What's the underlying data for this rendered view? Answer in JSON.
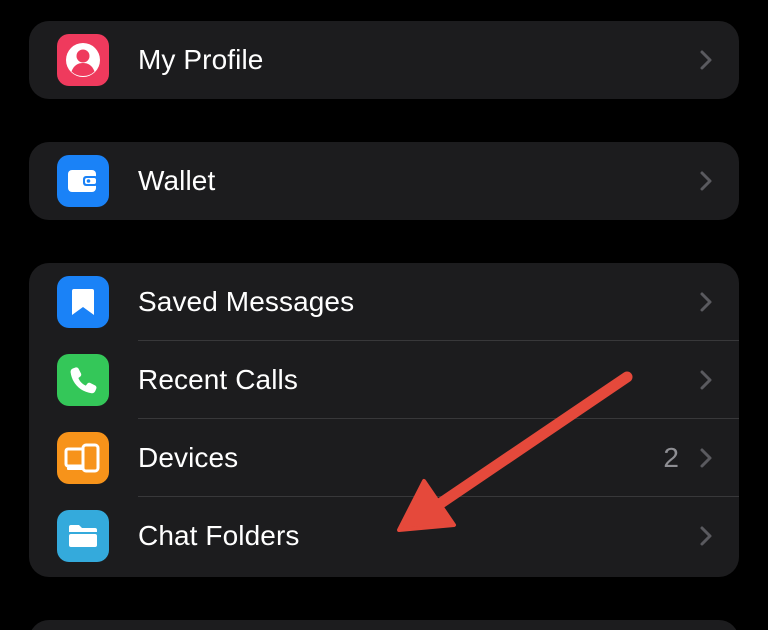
{
  "colors": {
    "background": "#000000",
    "group_background": "#1c1c1e",
    "separator": "#38383a",
    "label_text": "#ffffff",
    "secondary_text": "#8e8e93",
    "chevron": "#5a5a5f",
    "annotation_arrow": "#e5493b"
  },
  "settings": {
    "my_profile": {
      "label": "My Profile",
      "icon": "person-circle-icon",
      "icon_color": "#ef3a5d"
    },
    "wallet": {
      "label": "Wallet",
      "icon": "wallet-icon",
      "icon_color": "#1a82f7"
    },
    "saved_messages": {
      "label": "Saved Messages",
      "icon": "bookmark-icon",
      "icon_color": "#1a82f7"
    },
    "recent_calls": {
      "label": "Recent Calls",
      "icon": "phone-icon",
      "icon_color": "#34c759"
    },
    "devices": {
      "label": "Devices",
      "value": "2",
      "icon": "devices-icon",
      "icon_color": "#f7931a"
    },
    "chat_folders": {
      "label": "Chat Folders",
      "icon": "folder-icon",
      "icon_color": "#34aadc"
    }
  }
}
